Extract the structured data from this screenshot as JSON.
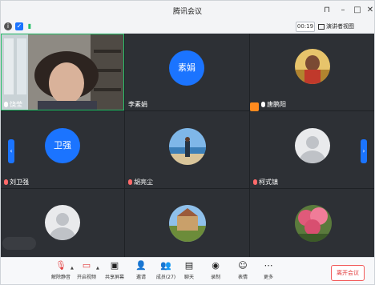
{
  "window": {
    "title": "腾讯会议"
  },
  "infobar": {
    "timer": "00:19",
    "view_label": "演讲者视图"
  },
  "participants": [
    {
      "name": "饶莹"
    },
    {
      "name": "李素娟",
      "avatar_text": "素娟"
    },
    {
      "name": "唐鹏阳"
    },
    {
      "name": "刘卫强",
      "avatar_text": "卫强"
    },
    {
      "name": "胡亮尘"
    },
    {
      "name": "柯式镇"
    }
  ],
  "toolbar": {
    "mute": "解除静音",
    "video": "开启视频",
    "share": "共享屏幕",
    "invite": "邀请",
    "members": "成员(27)",
    "chat": "聊天",
    "record": "录制",
    "reactions": "表情",
    "more": "更多",
    "leave": "离开会议"
  },
  "colors": {
    "accent": "#1b74ff",
    "active_speaker": "#27c16a",
    "leave": "#e23b3b"
  }
}
